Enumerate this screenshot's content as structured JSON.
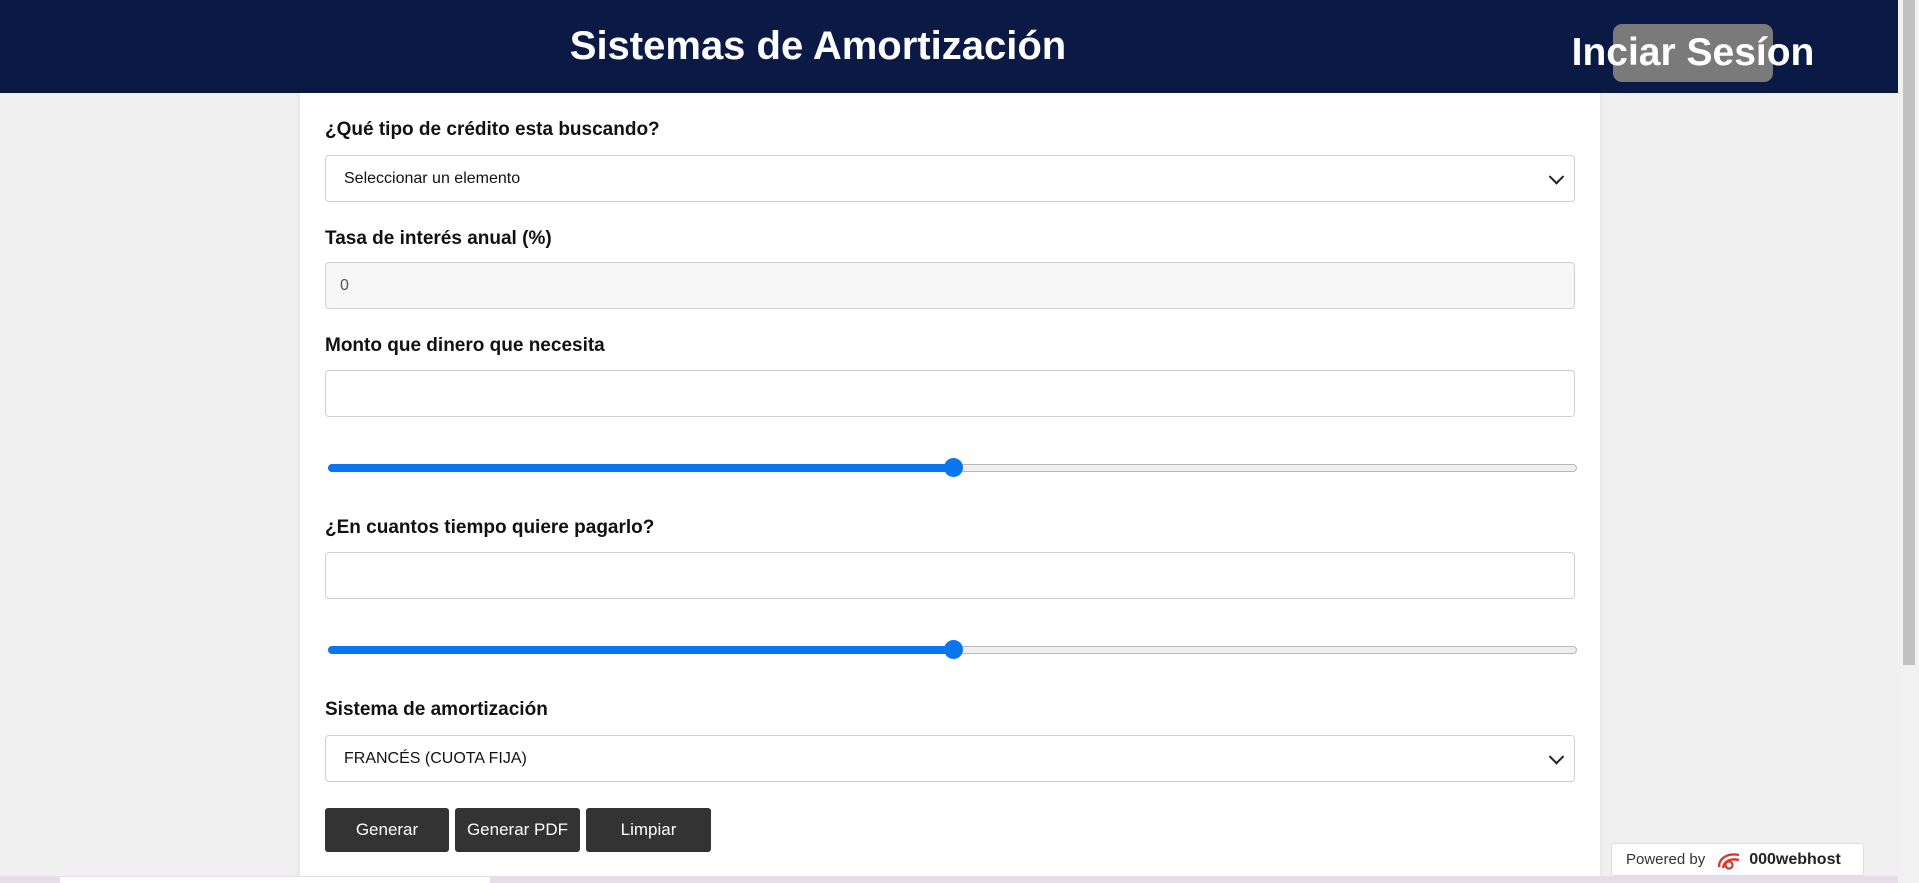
{
  "header": {
    "title": "Sistemas de Amortización",
    "login_label": "Inciar Sesíon",
    "background_color": "#0a1a45"
  },
  "form": {
    "credit_type": {
      "label": "¿Qué tipo de crédito esta buscando?",
      "selected": "Seleccionar un elemento"
    },
    "interest_rate": {
      "label": "Tasa de interés anual (%)",
      "value": "0"
    },
    "amount": {
      "label": "Monto que dinero que necesita",
      "value": "",
      "slider_fraction": 0.5
    },
    "term": {
      "label": "¿En cuantos tiempo quiere pagarlo?",
      "value": "",
      "slider_fraction": 0.5
    },
    "system": {
      "label": "Sistema de amortización",
      "selected": "FRANCÉS (CUOTA FIJA)"
    }
  },
  "actions": {
    "generate_label": "Generar",
    "pdf_label": "Generar PDF",
    "clear_label": "Limpiar",
    "button_color": "#333333"
  },
  "badge": {
    "powered_by": "Powered by",
    "brand": "000webhost",
    "logo_icon": "000webhost-logo-icon"
  },
  "colors": {
    "accent": "#0a75f0"
  }
}
